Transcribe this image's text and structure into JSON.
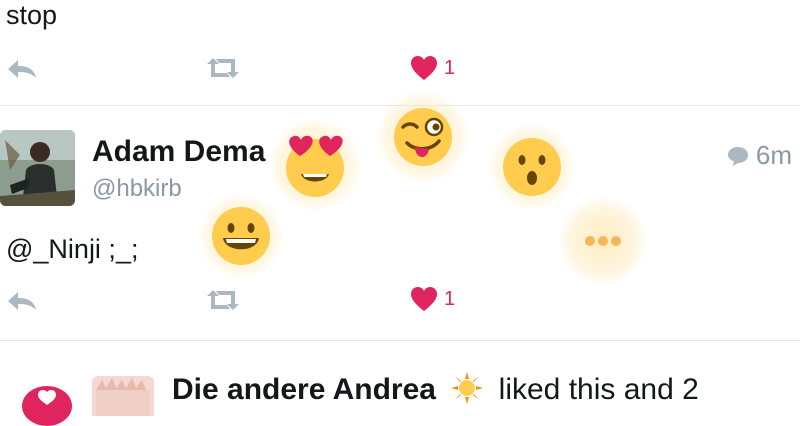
{
  "prev_tweet": {
    "text": "stop",
    "like_count": "1"
  },
  "tweet": {
    "name": "Adam Dema",
    "handle": "@hbkirb",
    "time": "6m",
    "text": "@_Ninji ;_;",
    "like_count": "1"
  },
  "reaction_picker": {
    "reactions": [
      "heart-eyes",
      "winking-tongue",
      "surprised",
      "grinning",
      "more"
    ]
  },
  "notification": {
    "name": "Die andere Andrea",
    "suffix": "liked this and 2"
  },
  "colors": {
    "like": "#e0245e",
    "icon_gray": "#aab8c2",
    "emoji_yellow": "#ffcc4d"
  }
}
